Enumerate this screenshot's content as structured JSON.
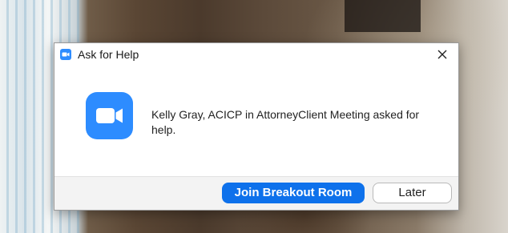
{
  "dialog": {
    "title": "Ask for Help",
    "app_icon": "zoom-app-icon",
    "close_icon": "close-icon",
    "logo_icon": "zoom-video-camera-icon",
    "message": "Kelly Gray, ACICP in AttorneyClient Meeting asked for help.",
    "buttons": {
      "join_label": "Join Breakout Room",
      "later_label": "Later"
    }
  },
  "colors": {
    "zoom_blue": "#2d8cff",
    "primary_button": "#0e71eb",
    "footer_bg": "#f3f3f3"
  }
}
